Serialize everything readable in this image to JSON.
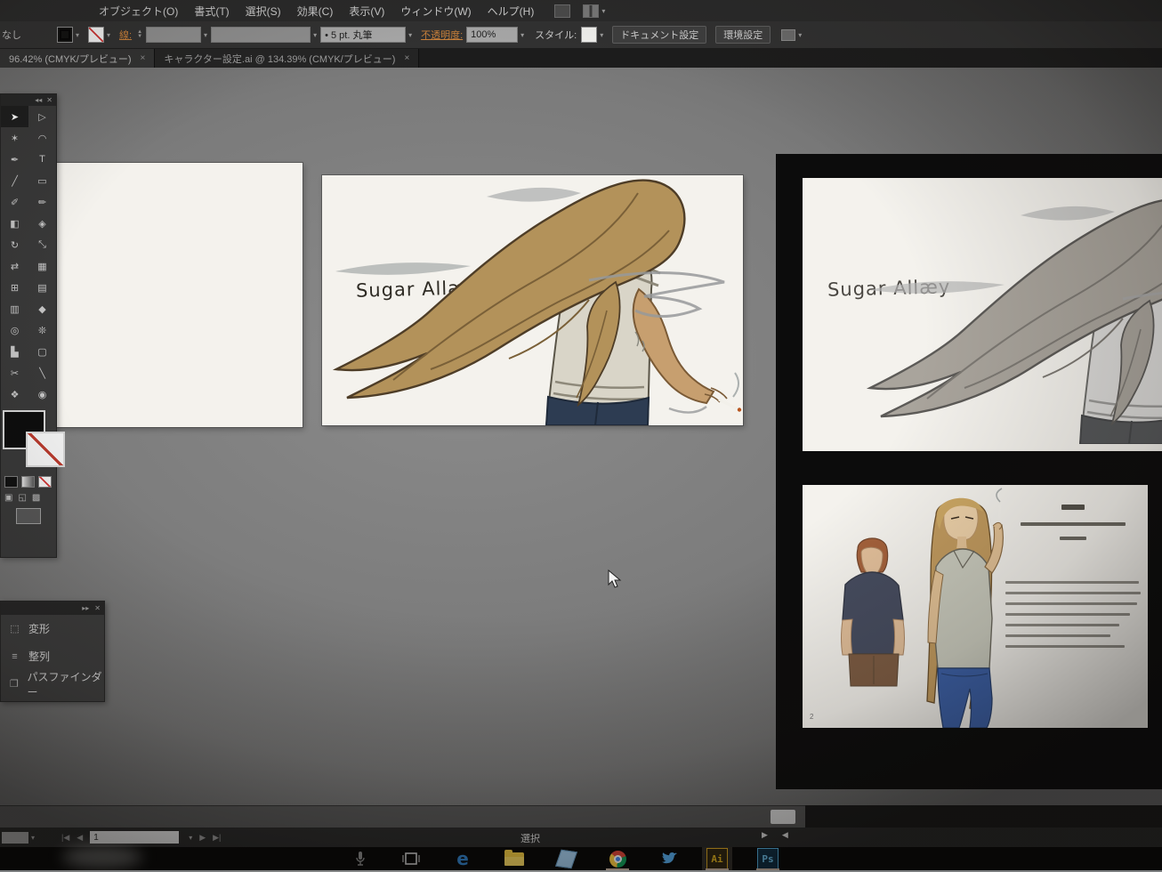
{
  "window": {
    "menus": [
      {
        "label": "オブジェクト(O)"
      },
      {
        "label": "書式(T)"
      },
      {
        "label": "選択(S)"
      },
      {
        "label": "効果(C)"
      },
      {
        "label": "表示(V)"
      },
      {
        "label": "ウィンドウ(W)"
      },
      {
        "label": "ヘルプ(H)"
      }
    ]
  },
  "control_bar": {
    "left_label": "なし",
    "stroke_label": "線:",
    "brush_label": "• 5 pt. 丸筆",
    "opacity_label": "不透明度:",
    "opacity_value": "100%",
    "style_label": "スタイル:",
    "doc_setup_button": "ドキュメント設定",
    "preferences_button": "環境設定"
  },
  "tab_bar": {
    "tabs": [
      {
        "label": "96.42% (CMYK/プレビュー)",
        "close": "×"
      },
      {
        "label": "キャラクター設定.ai @ 134.39% (CMYK/プレビュー)",
        "close": "×"
      }
    ]
  },
  "toolbar": {
    "collapse_glyph": "◂◂",
    "close_glyph": "✕",
    "tools": [
      {
        "name": "selection-tool",
        "glyph": "➤",
        "selected": true
      },
      {
        "name": "direct-selection-tool",
        "glyph": "▷"
      },
      {
        "name": "magic-wand-tool",
        "glyph": "✶"
      },
      {
        "name": "lasso-tool",
        "glyph": "◠"
      },
      {
        "name": "pen-tool",
        "glyph": "✒"
      },
      {
        "name": "type-tool",
        "glyph": "T"
      },
      {
        "name": "line-segment-tool",
        "glyph": "╱"
      },
      {
        "name": "rectangle-tool",
        "glyph": "▭"
      },
      {
        "name": "paintbrush-tool",
        "glyph": "✐"
      },
      {
        "name": "pencil-tool",
        "glyph": "✏"
      },
      {
        "name": "shape-builder-tool",
        "glyph": "◧"
      },
      {
        "name": "eraser-tool",
        "glyph": "◈"
      },
      {
        "name": "rotate-tool",
        "glyph": "↻"
      },
      {
        "name": "scale-tool",
        "glyph": "⤡"
      },
      {
        "name": "width-tool",
        "glyph": "⇄"
      },
      {
        "name": "free-transform-tool",
        "glyph": "▦"
      },
      {
        "name": "perspective-grid-tool",
        "glyph": "⊞"
      },
      {
        "name": "mesh-tool",
        "glyph": "▤"
      },
      {
        "name": "gradient-tool",
        "glyph": "▥"
      },
      {
        "name": "eyedropper-tool",
        "glyph": "◆"
      },
      {
        "name": "blend-tool",
        "glyph": "◎"
      },
      {
        "name": "symbol-sprayer-tool",
        "glyph": "❊"
      },
      {
        "name": "column-graph-tool",
        "glyph": "▙"
      },
      {
        "name": "artboard-tool",
        "glyph": "▢"
      },
      {
        "name": "slice-tool",
        "glyph": "✂"
      },
      {
        "name": "knife-tool",
        "glyph": "╲"
      },
      {
        "name": "hand-tool",
        "glyph": "❖"
      },
      {
        "name": "zoom-tool",
        "glyph": "◉"
      }
    ]
  },
  "panels": {
    "collapse_glyph": "▸▸",
    "close_glyph": "✕",
    "items": [
      {
        "label": "変形",
        "glyph": "⬚"
      },
      {
        "label": "整列",
        "glyph": "≡"
      },
      {
        "label": "パスファインダー",
        "glyph": "❐"
      }
    ]
  },
  "canvas": {
    "artboard_title": "Sugar Allæy",
    "sheet_page_number": "2",
    "sheet_text": {
      "title_width": 26,
      "subtitle_width": 118,
      "chapter_width": 30,
      "body_line_widths": [
        150,
        152,
        148,
        140,
        128,
        118,
        134
      ]
    }
  },
  "status_bar": {
    "artboard_value": "1",
    "selection_label": "選択"
  },
  "taskbar": {
    "edge_label": "e",
    "illustrator_label": "Ai",
    "photoshop_label": "Ps"
  },
  "colors": {
    "accent_orange": "#c9803a",
    "canvas_gray": "#7b7b7b",
    "right_window_black": "#0c0c0c",
    "artboard_white": "#f4f2ed",
    "illustrator_yellow": "#e8b71e",
    "photoshop_blue": "#6fc5f0"
  }
}
